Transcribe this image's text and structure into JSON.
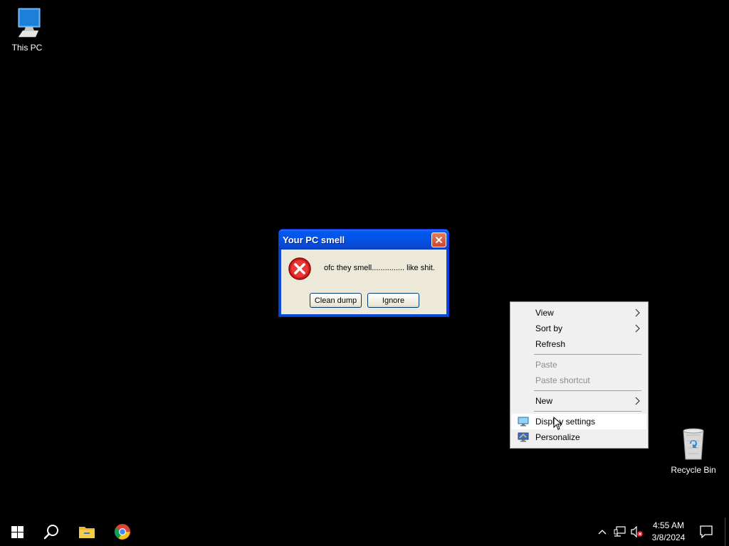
{
  "desktop": {
    "icons": [
      {
        "label": "This PC",
        "icon": "computer-icon"
      },
      {
        "label": "Recycle Bin",
        "icon": "recycle-bin-icon"
      }
    ]
  },
  "dialog": {
    "title": "Your PC smell",
    "message": "ofc they smell............... like shit.",
    "buttons": {
      "primary": "Clean dump",
      "secondary": "Ignore"
    },
    "icon": "error-icon",
    "colors": {
      "titlebar": "#0453e6",
      "body": "#ece9d8",
      "close": "#d0452a"
    }
  },
  "context_menu": {
    "items": [
      {
        "label": "View",
        "submenu": true
      },
      {
        "label": "Sort by",
        "submenu": true
      },
      {
        "label": "Refresh"
      },
      {
        "label": "Paste",
        "disabled": true
      },
      {
        "label": "Paste shortcut",
        "disabled": true
      },
      {
        "label": "New",
        "submenu": true
      },
      {
        "label": "Display settings",
        "icon": "display-icon",
        "highlighted": true
      },
      {
        "label": "Personalize",
        "icon": "personalize-icon"
      }
    ]
  },
  "taskbar": {
    "apps": [
      "start-icon",
      "search-icon",
      "file-explorer-icon",
      "chrome-icon"
    ],
    "tray": [
      "chevron-up-icon",
      "network-icon",
      "volume-muted-icon"
    ],
    "clock": {
      "time": "4:55 AM",
      "date": "3/8/2024"
    },
    "notification_icon": "notification-icon"
  }
}
